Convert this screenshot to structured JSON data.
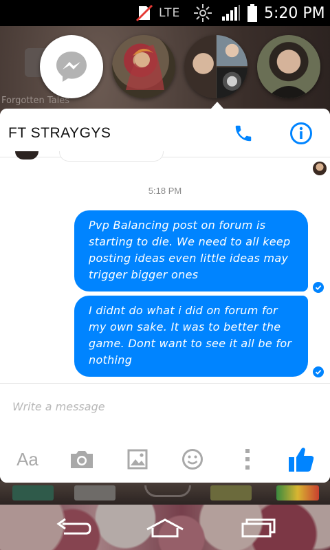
{
  "status_bar": {
    "network": "LTE",
    "time": "5:20 PM",
    "icons": [
      "no-sim-icon",
      "brightness-icon",
      "signal-icon",
      "battery-icon"
    ]
  },
  "background": {
    "app_label": "Forgotten Tales"
  },
  "chat_heads": [
    {
      "name": "messenger-head",
      "icon": "messenger-bolt-icon"
    },
    {
      "name": "chat-head-1"
    },
    {
      "name": "chat-head-group"
    },
    {
      "name": "chat-head-3"
    }
  ],
  "thread": {
    "title": "FT STRAYGYS",
    "timestamp": "5:18 PM",
    "messages": [
      {
        "text": "Pvp Balancing post on forum is starting to die. We need to all keep posting ideas even little ideas may trigger bigger ones"
      },
      {
        "text": "I didnt do what i did on forum for my own sake. It was to better the game. Dont want to see it all be for nothing"
      }
    ]
  },
  "composer": {
    "placeholder": "Write a message",
    "font_button": "Aa"
  },
  "colors": {
    "accent": "#0084ff",
    "bubble_text": "#ffffff",
    "icon_gray": "#a9a9a9"
  }
}
